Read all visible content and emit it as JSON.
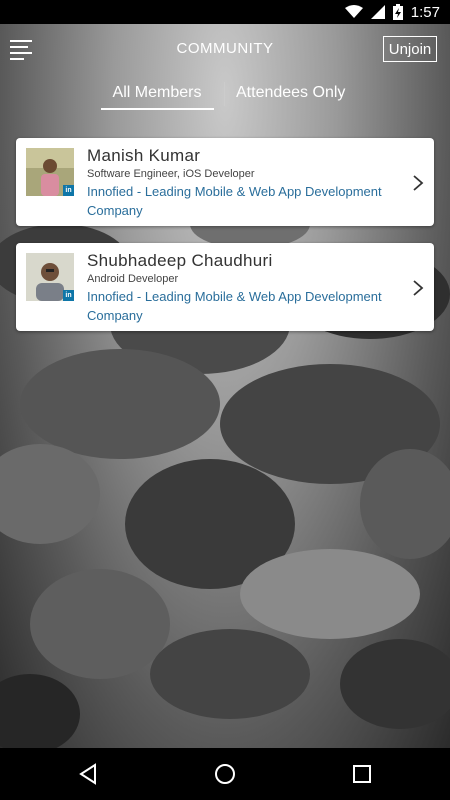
{
  "status_bar": {
    "time": "1:57",
    "icons": [
      "wifi-icon",
      "signal-icon",
      "battery-icon"
    ]
  },
  "header": {
    "title": "COMMUNITY",
    "menu_icon": "hamburger-menu-icon",
    "unjoin_label": "Unjoin"
  },
  "tabs": [
    {
      "label": "All Members",
      "active": true
    },
    {
      "label": "Attendees Only",
      "active": false
    }
  ],
  "members": [
    {
      "name": "Manish Kumar",
      "role": "Software Engineer, iOS Developer",
      "company": "Innofied - Leading Mobile & Web App Development Company",
      "badge": "in"
    },
    {
      "name": "Shubhadeep Chaudhuri",
      "role": "Android Developer",
      "company": "Innofied - Leading Mobile & Web App Development Company",
      "badge": "in"
    }
  ],
  "nav_bar": {
    "icons": [
      "back-icon",
      "home-icon",
      "recents-icon"
    ]
  },
  "colors": {
    "link": "#2a6e9b",
    "linkedin": "#0e76a8",
    "card_bg": "#ffffff"
  }
}
